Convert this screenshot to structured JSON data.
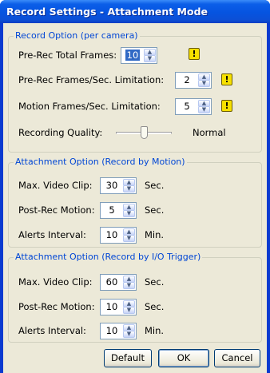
{
  "window": {
    "title": "Record Settings - Attachment Mode"
  },
  "record_option": {
    "legend": "Record Option (per camera)",
    "pre_rec_total_frames": {
      "label": "Pre-Rec Total Frames:",
      "value": "10"
    },
    "pre_rec_fps_limit": {
      "label": "Pre-Rec Frames/Sec. Limitation:",
      "value": "2"
    },
    "motion_fps_limit": {
      "label": "Motion Frames/Sec. Limitation:",
      "value": "5"
    },
    "recording_quality": {
      "label": "Recording Quality:",
      "value_text": "Normal",
      "level": 0.5
    },
    "warning_glyph": "!"
  },
  "attachment_motion": {
    "legend": "Attachment Option (Record by Motion)",
    "max_video_clip": {
      "label": "Max. Video Clip:",
      "value": "30",
      "unit": "Sec."
    },
    "post_rec_motion": {
      "label": "Post-Rec Motion:",
      "value": "5",
      "unit": "Sec."
    },
    "alerts_interval": {
      "label": "Alerts Interval:",
      "value": "10",
      "unit": "Min."
    }
  },
  "attachment_io": {
    "legend": "Attachment Option (Record by I/O Trigger)",
    "max_video_clip": {
      "label": "Max. Video Clip:",
      "value": "60",
      "unit": "Sec."
    },
    "post_rec_motion": {
      "label": "Post-Rec Motion:",
      "value": "10",
      "unit": "Sec."
    },
    "alerts_interval": {
      "label": "Alerts Interval:",
      "value": "10",
      "unit": "Min."
    }
  },
  "buttons": {
    "default": "Default",
    "ok": "OK",
    "cancel": "Cancel"
  }
}
